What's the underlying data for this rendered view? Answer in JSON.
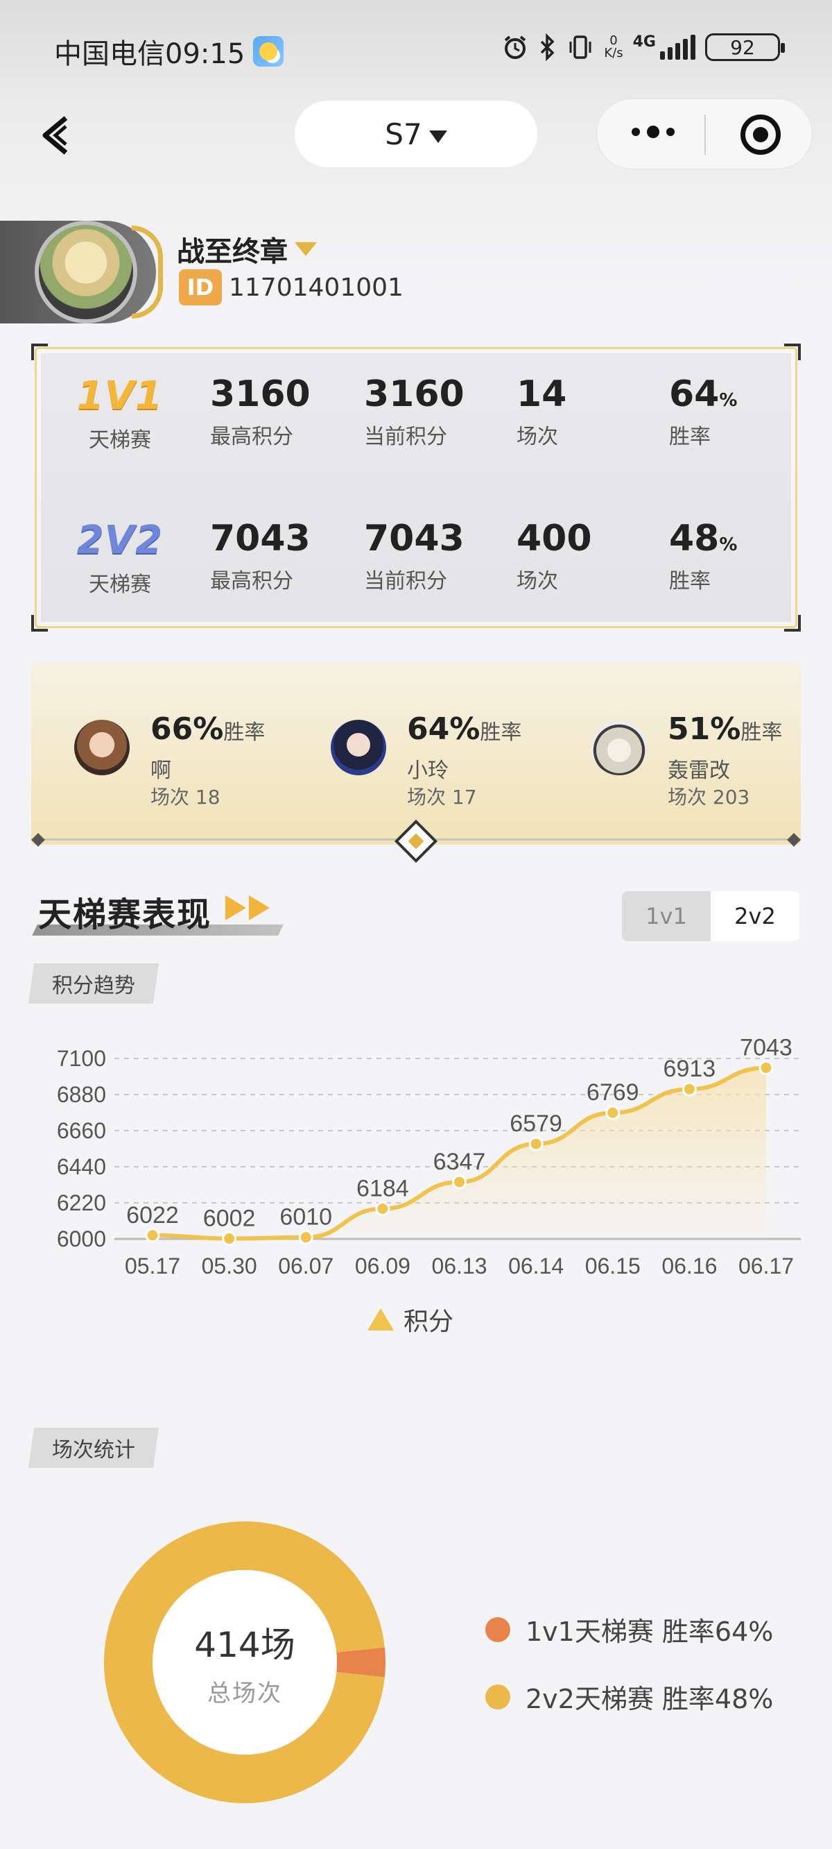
{
  "status_bar": {
    "carrier_time": "中国电信09:15",
    "net_speed_value": "0",
    "net_speed_unit": "K/s",
    "network": "4G",
    "battery": "92"
  },
  "nav": {
    "server": "S7"
  },
  "profile": {
    "name": "战至终章",
    "id_label": "ID",
    "id_value": "11701401001"
  },
  "stats": [
    {
      "mode_logo": "1V1",
      "mode_sub": "天梯赛",
      "max_score": "3160",
      "max_score_label": "最高积分",
      "cur_score": "3160",
      "cur_score_label": "当前积分",
      "matches": "14",
      "matches_label": "场次",
      "winrate": "64",
      "winrate_unit": "%",
      "winrate_label": "胜率"
    },
    {
      "mode_logo": "2V2",
      "mode_sub": "天梯赛",
      "max_score": "7043",
      "max_score_label": "最高积分",
      "cur_score": "7043",
      "cur_score_label": "当前积分",
      "matches": "400",
      "matches_label": "场次",
      "winrate": "48",
      "winrate_unit": "%",
      "winrate_label": "胜率"
    }
  ],
  "heroes": [
    {
      "rate": "66%",
      "rate_label": "胜率",
      "name": "啊",
      "count": "场次 18"
    },
    {
      "rate": "64%",
      "rate_label": "胜率",
      "name": "小玲",
      "count": "场次 17"
    },
    {
      "rate": "51%",
      "rate_label": "胜率",
      "name": "轰雷改",
      "count": "场次 203"
    }
  ],
  "section": {
    "title": "天梯赛表现",
    "toggle": [
      "1v1",
      "2v2"
    ],
    "toggle_active": "2v2",
    "trend_tag": "积分趋势",
    "count_tag": "场次统计"
  },
  "chart_data": [
    {
      "type": "area",
      "categories": [
        "05.17",
        "05.30",
        "06.07",
        "06.09",
        "06.13",
        "06.14",
        "06.15",
        "06.16",
        "06.17"
      ],
      "series": [
        {
          "name": "积分",
          "values": [
            6022,
            6002,
            6010,
            6184,
            6347,
            6579,
            6769,
            6913,
            7043
          ]
        }
      ],
      "ylim": [
        6000,
        7100
      ],
      "yticks": [
        6000,
        6220,
        6440,
        6660,
        6880,
        7100
      ],
      "grid": true,
      "legend": "bottom-center",
      "color": "#f0c24e"
    },
    {
      "type": "pie",
      "center_value": "414场",
      "center_label": "总场次",
      "series": [
        {
          "name": "1v1天梯赛 胜率64%",
          "value": 14,
          "color": "#e8844a"
        },
        {
          "name": "2v2天梯赛 胜率48%",
          "value": 400,
          "color": "#ecb84a"
        }
      ],
      "legend": "right"
    }
  ]
}
